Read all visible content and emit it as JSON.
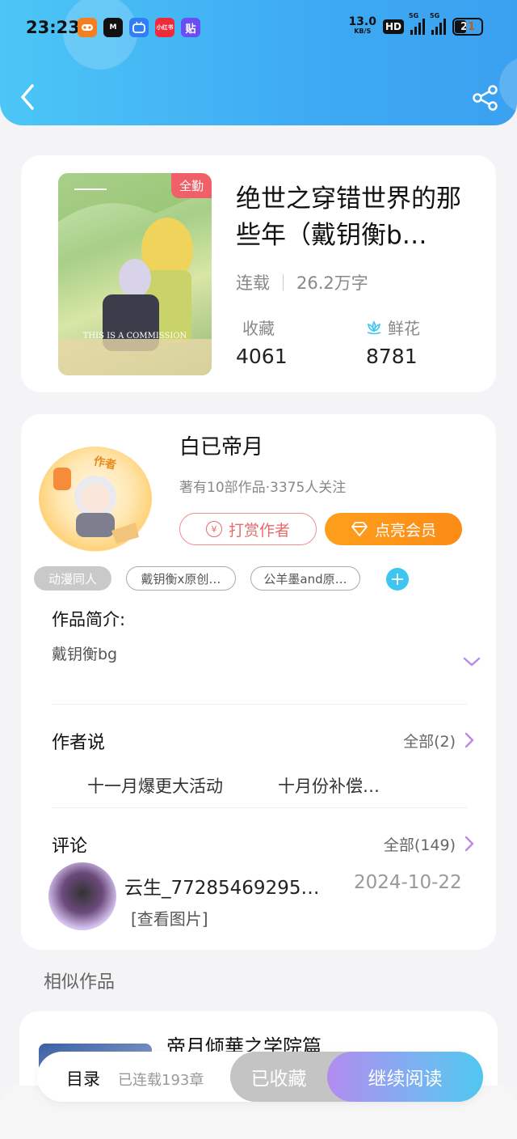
{
  "status_bar": {
    "time": "23:23",
    "apps": [
      {
        "icon": "game-app-icon",
        "color": "#f57f1f",
        "label": ""
      },
      {
        "icon": "m-app-icon",
        "color": "#111111",
        "label": "M"
      },
      {
        "icon": "bili-app-icon",
        "color": "#2f7ef5",
        "label": ""
      },
      {
        "icon": "xiaohongshu-app-icon",
        "color": "#ef2a3c",
        "label": "小红书"
      },
      {
        "icon": "tieba-app-icon",
        "color": "#6a4ef5",
        "label": "贴"
      }
    ],
    "net_speed_value": "13.0",
    "net_speed_unit": "KB/S",
    "hd": "HD",
    "signal_label": "5G",
    "battery": "21"
  },
  "colors": {
    "header_start": "#4cc6f6",
    "header_end": "#3aa1f0",
    "tag_add": "#3ec6f2",
    "vip_button": "#fb8b16",
    "tip_button": "#e86a6a",
    "flower_icon": "#3ec6f2",
    "chevron": "#b98ce8"
  },
  "book": {
    "cover_badge": "全勤",
    "cover_caption": "THIS IS A COMMISSION",
    "title": "绝世之穿错世界的那些年（戴钥衡b…",
    "status": "连载",
    "word_count": "26.2万字",
    "collect_label": "收藏",
    "collect_count": "4061",
    "flower_label": "鲜花",
    "flower_count": "8781"
  },
  "author": {
    "badge": "作者",
    "name": "白已帝月",
    "stats": "著有10部作品·3375人关注",
    "tip_label": "打赏作者",
    "tip_icon": "¥",
    "vip_label": "点亮会员"
  },
  "tags": [
    "动漫同人",
    "戴钥衡x原创…",
    "公羊墨and原…"
  ],
  "tag_add": "+",
  "intro": {
    "title": "作品简介:",
    "text": "戴钥衡bg"
  },
  "author_says": {
    "title": "作者说",
    "more": "全部(2)",
    "posts": [
      "十一月爆更大活动",
      "十月份补偿…"
    ]
  },
  "comments": {
    "title": "评论",
    "more": "全部(149)",
    "first": {
      "user": "云生_77285469295…",
      "date": "2024-10-22",
      "text": "[查看图片]"
    }
  },
  "similar": {
    "title": "相似作品",
    "first_title": "帝月倾華之学院篇"
  },
  "bottom_bar": {
    "toc": "目录",
    "chapters": "已连载193章",
    "collected": "已收藏",
    "continue": "继续阅读"
  }
}
